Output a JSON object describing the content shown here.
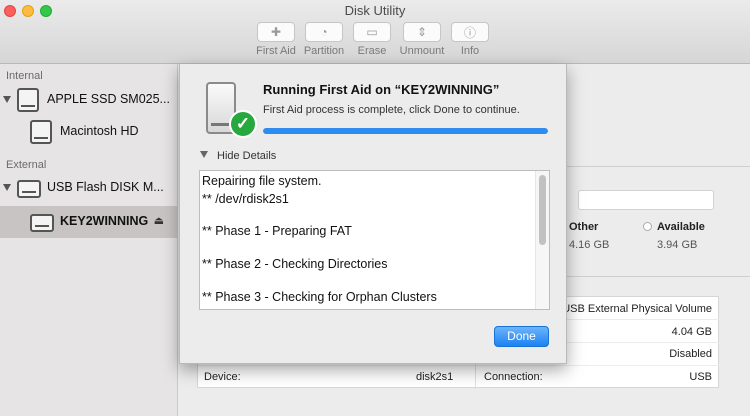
{
  "window": {
    "title": "Disk Utility"
  },
  "toolbar": {
    "items": [
      {
        "label": "First Aid",
        "icon": "stethoscope-icon"
      },
      {
        "label": "Partition",
        "icon": "partition-icon"
      },
      {
        "label": "Erase",
        "icon": "erase-icon"
      },
      {
        "label": "Unmount",
        "icon": "unmount-icon"
      },
      {
        "label": "Info",
        "icon": "info-icon"
      }
    ]
  },
  "sidebar": {
    "internal_header": "Internal",
    "external_header": "External",
    "items": [
      {
        "label": "APPLE SSD SM025...",
        "icon": "hard-drive-icon"
      },
      {
        "label": "Macintosh HD",
        "icon": "volume-icon"
      },
      {
        "label": "USB Flash DISK M...",
        "icon": "usb-drive-icon"
      },
      {
        "label": "KEY2WINNING",
        "icon": "volume-icon",
        "selected": true
      }
    ]
  },
  "main": {
    "legend": [
      {
        "label": "Other",
        "size": "4.16 GB"
      },
      {
        "label": "Available",
        "size": "3.94 GB"
      }
    ],
    "info": {
      "location": "USB External Physical Volume",
      "capacity": "4.04 GB",
      "owners": "Disabled",
      "device_label": "Device:",
      "device_value": "disk2s1",
      "connection_label": "Connection:",
      "connection_value": "USB"
    }
  },
  "dialog": {
    "title": "Running First Aid on “KEY2WINNING”",
    "subtitle": "First Aid process is complete, click Done to continue.",
    "progress": 1.0,
    "toggle_label": "Hide Details",
    "log_lines": [
      "Repairing file system.",
      "** /dev/rdisk2s1",
      "",
      "** Phase 1 - Preparing FAT",
      "",
      "** Phase 2 - Checking Directories",
      "",
      "** Phase 3 - Checking for Orphan Clusters"
    ],
    "done_label": "Done"
  },
  "colors": {
    "accent": "#1b82f2",
    "success": "#27a83e",
    "selected_row": "#c9c4c4"
  }
}
